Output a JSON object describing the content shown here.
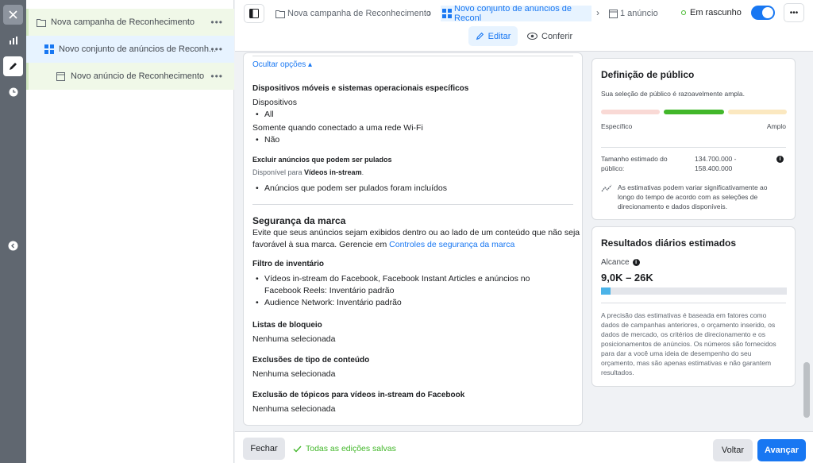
{
  "tree": {
    "campaign": "Nova campanha de Reconhecimento",
    "adset": "Novo conjunto de anúncios de Reconh...",
    "ad": "Novo anúncio de Reconhecimento",
    "more": "•••"
  },
  "topbar": {
    "crumb_campaign": "Nova campanha de Reconhecimento",
    "crumb_adset": "Novo conjunto de anúncios de Reconl",
    "crumb_ads": "1 anúncio",
    "status": "Em rascunho",
    "more": "•••",
    "edit_label": "Editar",
    "review_label": "Conferir"
  },
  "main": {
    "hide_options": "Ocultar opções ▴",
    "devices_title": "Dispositivos móveis e sistemas operacionais específicos",
    "devices_label": "Dispositivos",
    "devices_value": "All",
    "wifi_label": "Somente quando conectado a uma rede Wi-Fi",
    "wifi_value": "Não",
    "skippable_title": "Excluir anúncios que podem ser pulados",
    "skippable_available_prefix": "Disponível para ",
    "skippable_available_bold": "Vídeos in-stream",
    "skippable_available_suffix": ".",
    "skippable_value": "Anúncios que podem ser pulados foram incluídos",
    "brand_title": "Segurança da marca",
    "brand_desc_1": "Evite que seus anúncios sejam exibidos dentro ou ao lado de um conteúdo que não seja",
    "brand_desc_2": "favorável à sua marca. Gerencie em ",
    "brand_link": "Controles de segurança da marca",
    "inventory_title": "Filtro de inventário",
    "inventory_item_1a": "Vídeos in-stream do Facebook, Facebook Instant Articles e anúncios no",
    "inventory_item_1b": "Facebook Reels: Inventário padrão",
    "inventory_item_2": "Audience Network: Inventário padrão",
    "blocklists_title": "Listas de bloqueio",
    "blocklists_value": "Nenhuma selecionada",
    "content_type_title": "Exclusões de tipo de conteúdo",
    "content_type_value": "Nenhuma selecionada",
    "topics_title": "Exclusão de tópicos para vídeos in-stream do Facebook",
    "topics_value": "Nenhuma selecionada"
  },
  "audience": {
    "title": "Definição de público",
    "subtitle": "Sua seleção de público é razoavelmente ampla.",
    "specific_label": "Específico",
    "broad_label": "Amplo",
    "size_label_1": "Tamanho estimado do",
    "size_label_2": "público:",
    "size_value_1": "134.700.000 -",
    "size_value_2": "158.400.000",
    "note_1": "As estimativas podem variar significativamente ao",
    "note_2": "longo do tempo de acordo com as seleções de",
    "note_3": "direcionamento e dados disponíveis.",
    "colors": {
      "specific": "#f9d9d5",
      "middle": "#42b72a",
      "broad": "#fbe8c0"
    }
  },
  "daily": {
    "title": "Resultados diários estimados",
    "reach_label": "Alcance",
    "reach_value": "9,0K – 26K",
    "reach_fill_fraction": 0.05,
    "disclaimer": [
      "A precisão das estimativas é baseada em fatores como",
      "dados de campanhas anteriores, o orçamento inserido, os",
      "dados de mercado, os critérios de direcionamento e os",
      "posicionamentos de anúncios. Os números são fornecidos",
      "para dar a você uma ideia de desempenho do seu",
      "orçamento, mas são apenas estimativas e não garantem",
      "resultados."
    ]
  },
  "footer": {
    "close_label": "Fechar",
    "saved_label": "Todas as edições salvas",
    "back_label": "Voltar",
    "next_label": "Avançar"
  },
  "colors": {
    "accent": "#1877f2",
    "saved_green": "#42b72a",
    "tree_highlight": "#e7f3ff",
    "tree_campaign_bg": "#f0f8e8"
  }
}
